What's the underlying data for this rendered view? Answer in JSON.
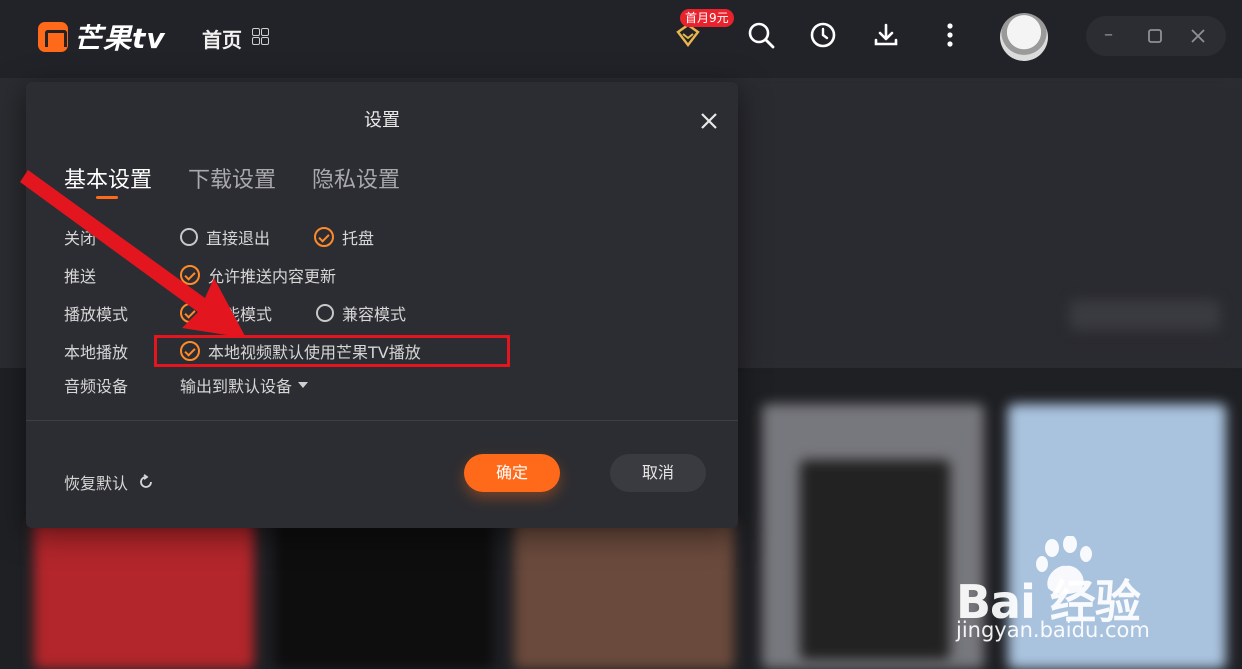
{
  "app": {
    "logo_text": "芒果tv",
    "home_tab": "首页",
    "vip_badge": "首月9元"
  },
  "settings_dialog": {
    "title": "设置",
    "tabs": [
      "基本设置",
      "下载设置",
      "隐私设置"
    ],
    "active_tab": "基本设置",
    "rows": [
      {
        "label": "关闭",
        "options": [
          {
            "text": "直接退出",
            "checked": false
          },
          {
            "text": "托盘",
            "checked": true
          }
        ]
      },
      {
        "label": "推送",
        "options": [
          {
            "text": "允许推送内容更新",
            "checked": true
          }
        ]
      },
      {
        "label": "播放模式",
        "options": [
          {
            "text": "智能模式",
            "checked": true
          },
          {
            "text": "兼容模式",
            "checked": false
          }
        ]
      },
      {
        "label": "本地播放",
        "options": [
          {
            "text": "本地视频默认使用芒果TV播放",
            "checked": true
          }
        ]
      },
      {
        "label": "音频设备",
        "select_value": "输出到默认设备"
      }
    ],
    "restore_label": "恢复默认",
    "ok_label": "确定",
    "cancel_label": "取消"
  },
  "watermark": {
    "brand": "Bai  经验",
    "url": "jingyan.baidu.com"
  },
  "colors": {
    "accent": "#ff6a1a",
    "annotation_red": "#e3161f",
    "dialog_bg": "#2c2d32"
  }
}
